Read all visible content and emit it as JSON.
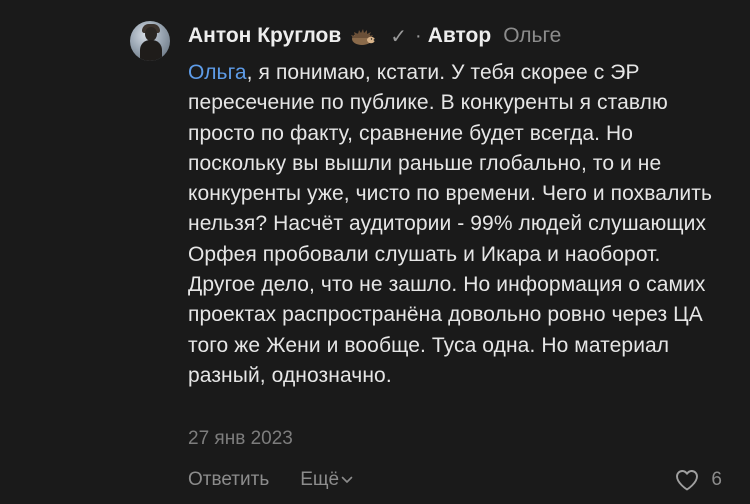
{
  "comment": {
    "author_name": "Антон Круглов",
    "author_emoji": "hedgehog-icon",
    "verified_icon": "✓",
    "separator": "·",
    "author_badge": "Автор",
    "reply_to": "Ольге",
    "mention": "Ольга",
    "text": ", я понимаю, кстати. У тебя скорее с ЭР пересечение по публике. В конкуренты я ставлю просто по факту, сравнение будет всегда. Но поскольку вы вышли раньше глобально, то и не конкуренты уже, чисто по времени. Чего и похвалить нельзя? Насчёт аудитории - 99% людей слушающих Орфея пробовали слушать и Икара и наоборот. Другое дело, что не зашло. Но информация о самих проектах распространёна довольно ровно через ЦА того же Жени и вообще. Туса одна. Но материал разный, однозначно.",
    "date": "27 янв 2023",
    "reply_label": "Ответить",
    "more_label": "Ещё",
    "likes_count": "6"
  },
  "colors": {
    "background": "#1a1a1a",
    "text": "#e6e6e6",
    "muted": "#8c8c8c",
    "mention": "#5e9ce8"
  }
}
